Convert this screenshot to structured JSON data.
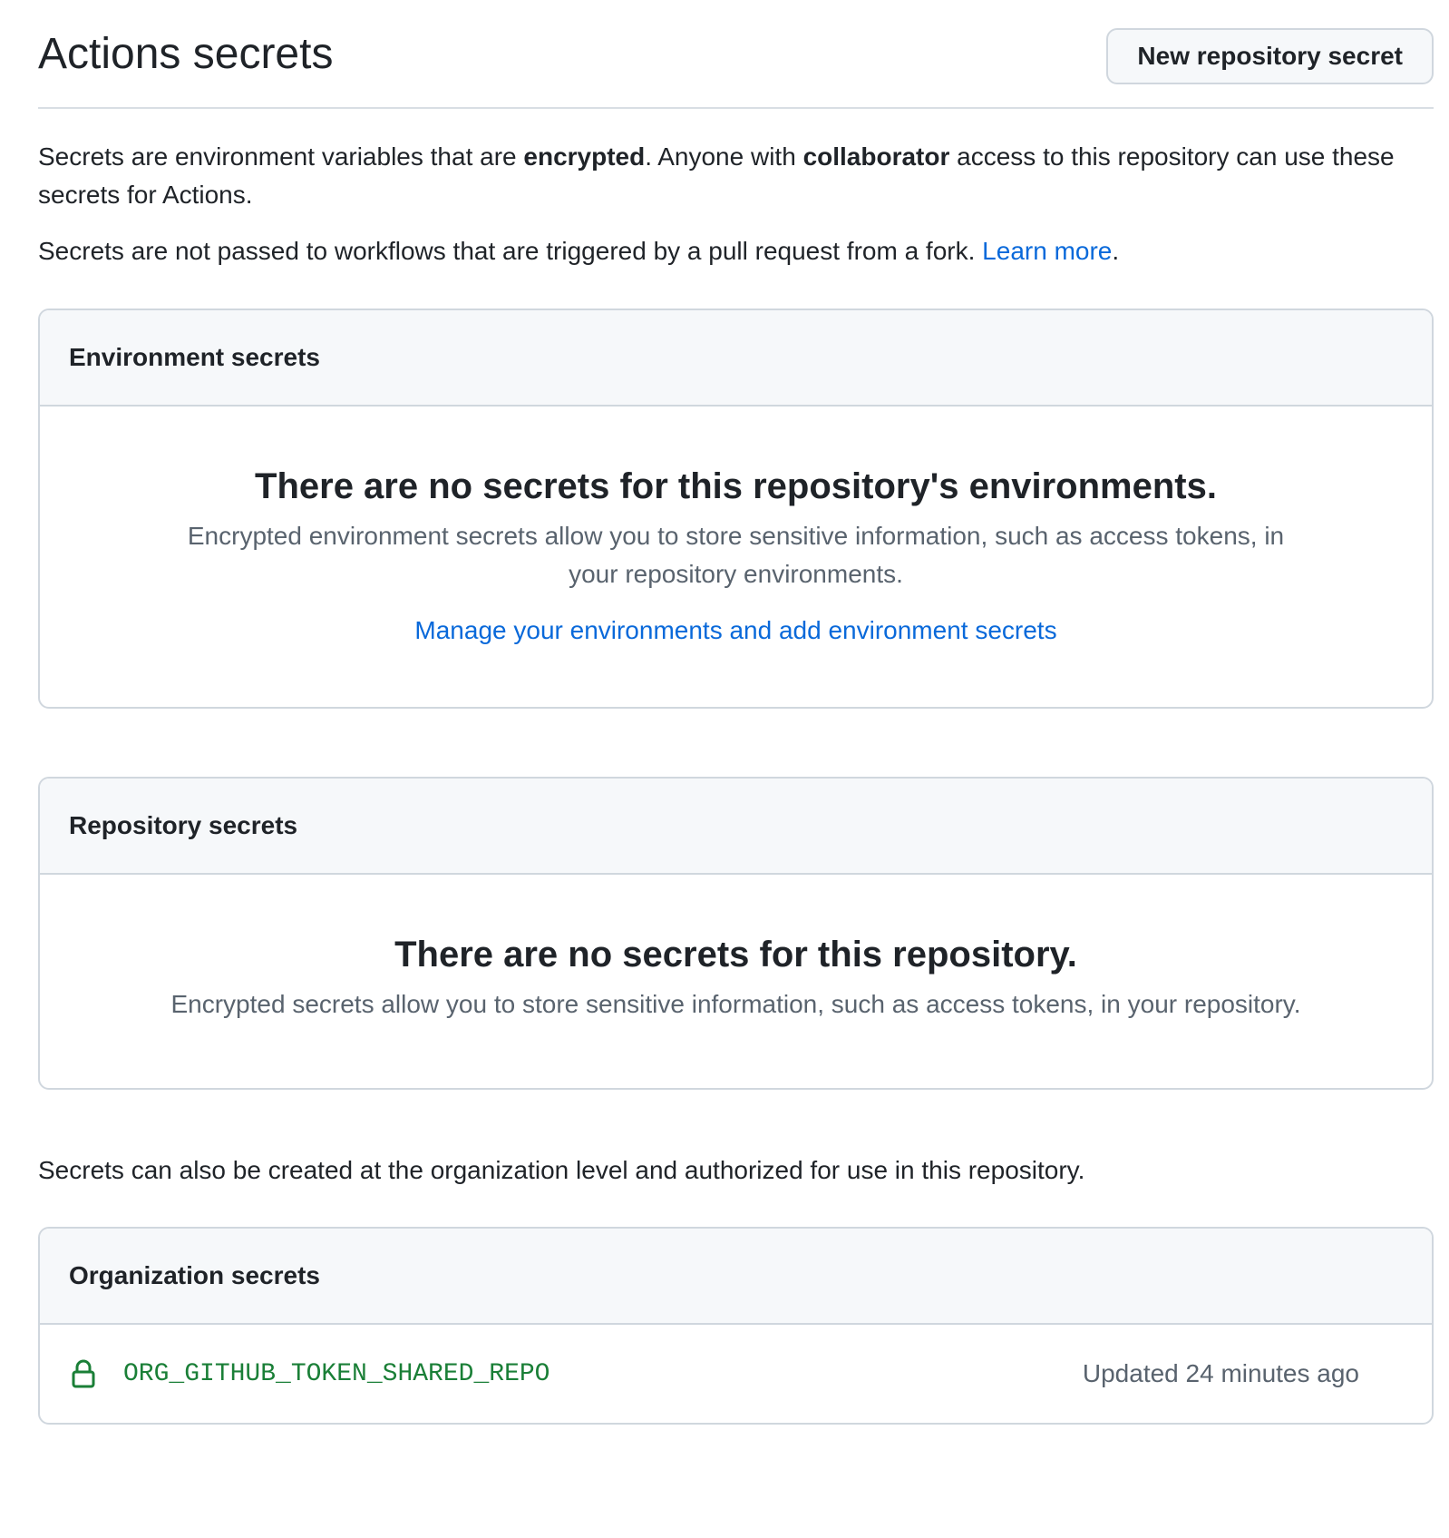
{
  "header": {
    "title": "Actions secrets",
    "new_secret_button": "New repository secret"
  },
  "intro": {
    "p1_a": "Secrets are environment variables that are ",
    "p1_b": "encrypted",
    "p1_c": ". Anyone with ",
    "p1_d": "collaborator",
    "p1_e": " access to this repository can use these secrets for Actions.",
    "p2_a": "Secrets are not passed to workflows that are triggered by a pull request from a fork. ",
    "p2_link": "Learn more",
    "p2_b": "."
  },
  "environment_secrets": {
    "header": "Environment secrets",
    "empty_title": "There are no secrets for this repository's environments.",
    "empty_desc": "Encrypted environment secrets allow you to store sensitive information, such as access tokens, in your repository environments.",
    "manage_link": "Manage your environments and add environment secrets"
  },
  "repository_secrets": {
    "header": "Repository secrets",
    "empty_title": "There are no secrets for this repository.",
    "empty_desc": "Encrypted secrets allow you to store sensitive information, such as access tokens, in your repository."
  },
  "org_note": "Secrets can also be created at the organization level and authorized for use in this repository.",
  "organization_secrets": {
    "header": "Organization secrets",
    "items": [
      {
        "icon": "lock-icon",
        "name": "ORG_GITHUB_TOKEN_SHARED_REPO",
        "updated": "Updated 24 minutes ago"
      }
    ]
  },
  "colors": {
    "link": "#0969da",
    "secret_name": "#1a7f37",
    "muted": "#59636e",
    "border": "#d0d7de",
    "header_bg": "#f6f8fa"
  }
}
